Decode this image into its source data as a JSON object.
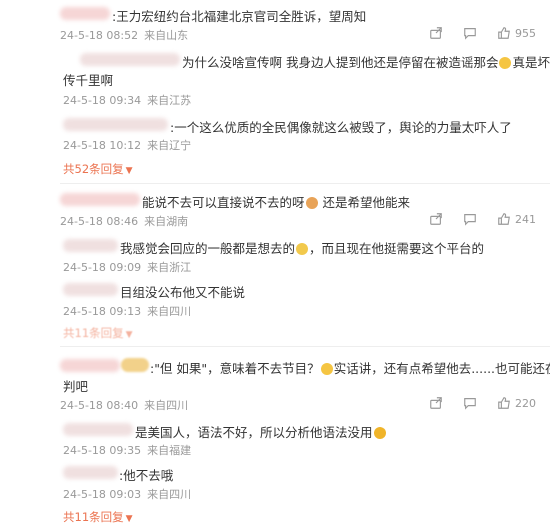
{
  "threads": [
    {
      "main": {
        "text": ":王力宏纽约台北福建北京官司全胜诉，望周知",
        "date": "24-5-18 08:52",
        "loc": "来自山东",
        "like_count": "955"
      },
      "replies": [
        {
          "text_line1": "为什么没啥宣传啊 我身边人提到他还是停留在被造谣那会",
          "text_line1_end": "真是坏事",
          "text_line2": "传千里啊",
          "date": "24-5-18 09:34",
          "loc": "来自江苏"
        },
        {
          "text": ":一个这么优质的全民偶像就这么被毁了，舆论的力量太吓人了",
          "date": "24-5-18 10:12",
          "loc": "来自辽宁"
        }
      ],
      "more": "共52条回复"
    },
    {
      "main": {
        "text": "能说不去可以直接说不去的呀",
        "text_end": "还是希望他能来",
        "date": "24-5-18 08:46",
        "loc": "来自湖南",
        "like_count": "241"
      },
      "replies": [
        {
          "text": "我感觉会回应的一般都是想去的",
          "text_end": "，而且现在他挺需要这个平台的",
          "date": "24-5-18 09:09",
          "loc": "来自浙江"
        },
        {
          "text": "目组没公布他又不能说",
          "date": "24-5-18 09:13",
          "loc": "来自四川"
        }
      ],
      "more": "共11条回复"
    },
    {
      "main": {
        "text": ":\"但 如果\"，意味着不去节目？",
        "text_end": "实话讲，还有点希望他去......也可能还在谈",
        "text_line2": "判吧",
        "date": "24-5-18 08:40",
        "loc": "来自四川",
        "like_count": "220"
      },
      "replies": [
        {
          "text": "是美国人，语法不好，所以分析他语法没用",
          "date": "24-5-18 09:35",
          "loc": "来自福建"
        },
        {
          "text": ":他不去哦",
          "date": "24-5-18 09:03",
          "loc": "来自四川"
        }
      ],
      "more": "共11条回复"
    }
  ]
}
